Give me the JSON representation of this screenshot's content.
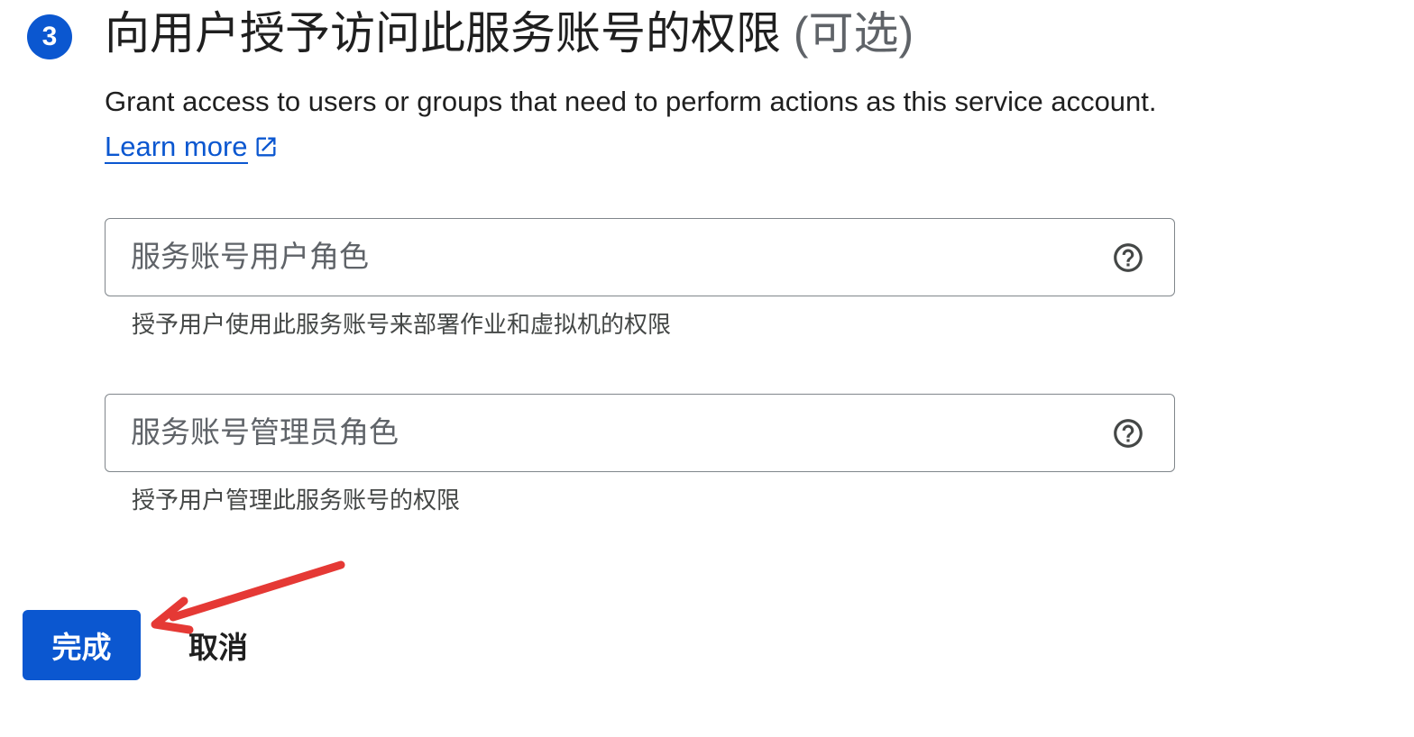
{
  "step": {
    "number": "3",
    "title": "向用户授予访问此服务账号的权限",
    "optional_label": "(可选)"
  },
  "description": {
    "text": "Grant access to users or groups that need to perform actions as this service account.",
    "learn_more_label": "Learn more"
  },
  "fields": [
    {
      "placeholder": "服务账号用户角色",
      "value": "",
      "hint": "授予用户使用此服务账号来部署作业和虚拟机的权限"
    },
    {
      "placeholder": "服务账号管理员角色",
      "value": "",
      "hint": "授予用户管理此服务账号的权限"
    }
  ],
  "actions": {
    "done_label": "完成",
    "cancel_label": "取消"
  },
  "colors": {
    "primary": "#0b57d0",
    "annotation_arrow": "#e53935"
  },
  "icons": {
    "field_help": "help-circle-icon",
    "external_link": "open-in-new-icon"
  }
}
